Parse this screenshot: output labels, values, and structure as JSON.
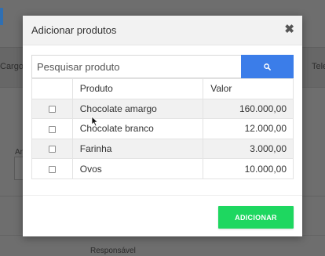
{
  "background": {
    "left_label": "Cargo",
    "right_label": "Tele",
    "field_label": "An",
    "bottom_label": "Responsável"
  },
  "modal": {
    "title": "Adicionar produtos",
    "close_icon": "close-icon",
    "search": {
      "placeholder": "Pesquisar produto",
      "value": "",
      "button_icon": "search-icon",
      "button_color": "#3b7de9"
    },
    "table": {
      "columns": [
        "",
        "Produto",
        "Valor"
      ],
      "rows": [
        {
          "checked": false,
          "product": "Chocolate amargo",
          "value": "160.000,00"
        },
        {
          "checked": false,
          "product": "Chocolate branco",
          "value": "12.000,00"
        },
        {
          "checked": false,
          "product": "Farinha",
          "value": "3.000,00"
        },
        {
          "checked": false,
          "product": "Ovos",
          "value": "10.000,00"
        }
      ]
    },
    "add_button": {
      "label": "ADICIONAR",
      "color": "#1ed760"
    }
  }
}
